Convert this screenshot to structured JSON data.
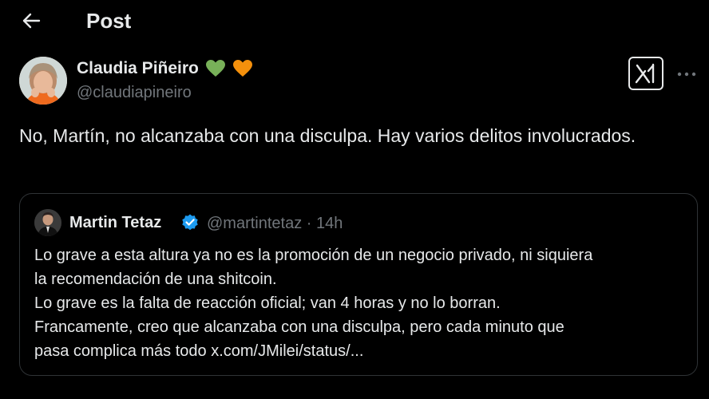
{
  "header": {
    "title": "Post"
  },
  "author": {
    "name": "Claudia Piñeiro",
    "handle": "@claudiapineiro",
    "emoji": [
      "green-heart",
      "orange-heart"
    ]
  },
  "post": {
    "text": "No, Martín, no alcanzaba con una disculpa. Hay varios delitos involucrados."
  },
  "quote": {
    "name": "Martin Tetaz",
    "handle": "@martintetaz",
    "separator": "·",
    "time": "14h",
    "lines": [
      "Lo grave a esta altura ya no es la promoción de un negocio privado, ni siquiera",
      "la recomendación de una shitcoin.",
      "Lo grave es la falta de reacción oficial; van 4 horas y no lo borran.",
      "Francamente, creo que alcanzaba con una disculpa, pero cada minuto que",
      "pasa complica más todo x.com/JMilei/status/..."
    ]
  },
  "colors": {
    "background": "#000000",
    "text": "#e7e9ea",
    "muted": "#71767b",
    "border": "#2f3336",
    "verified": "#1d9bf0",
    "green_heart": "#78b159",
    "orange_heart": "#f4900c"
  }
}
